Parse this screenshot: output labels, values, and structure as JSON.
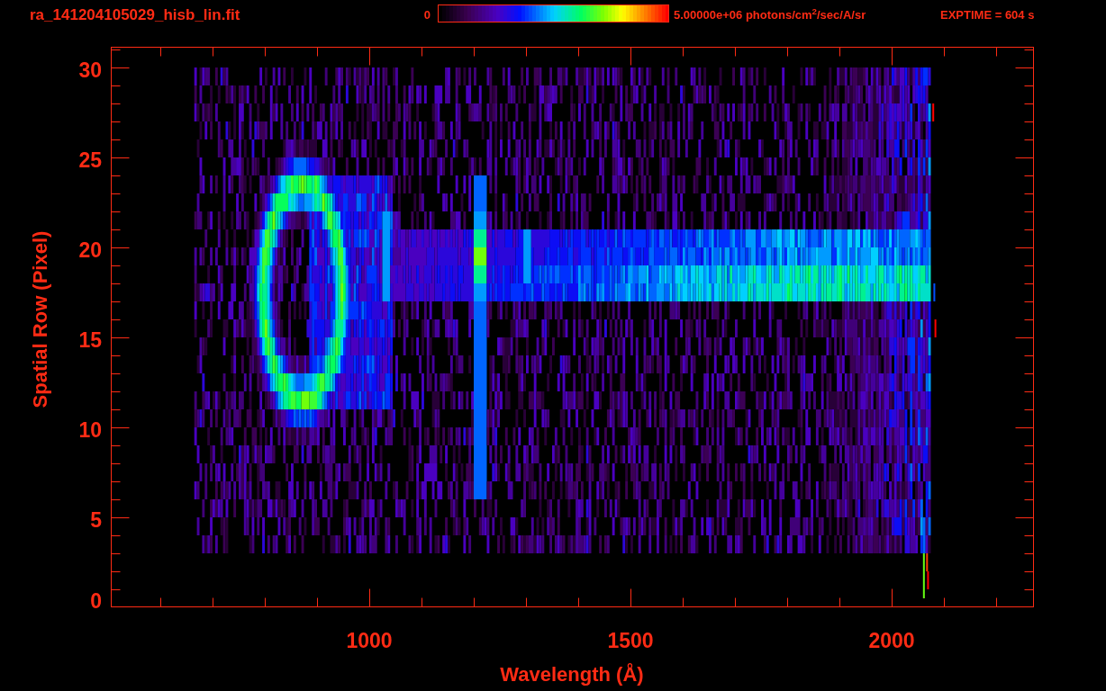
{
  "header": {
    "title": "ra_141204105029_hisb_lin.fit",
    "colorbar_min": "0",
    "colorbar_max": "5.00000e+06 photons/cm$^{2}$/sec/A/sr",
    "exposure": "EXPTIME = 604 s"
  },
  "plot": {
    "y_axis": {
      "label": "Spatial Row (Pixel)",
      "ticks": [
        "30",
        "25",
        "20",
        "15",
        "10",
        "5",
        "0"
      ]
    },
    "x_axis": {
      "label": "Wavelength (Å)",
      "ticks": [
        "1000",
        "1500",
        "2000"
      ]
    }
  }
}
